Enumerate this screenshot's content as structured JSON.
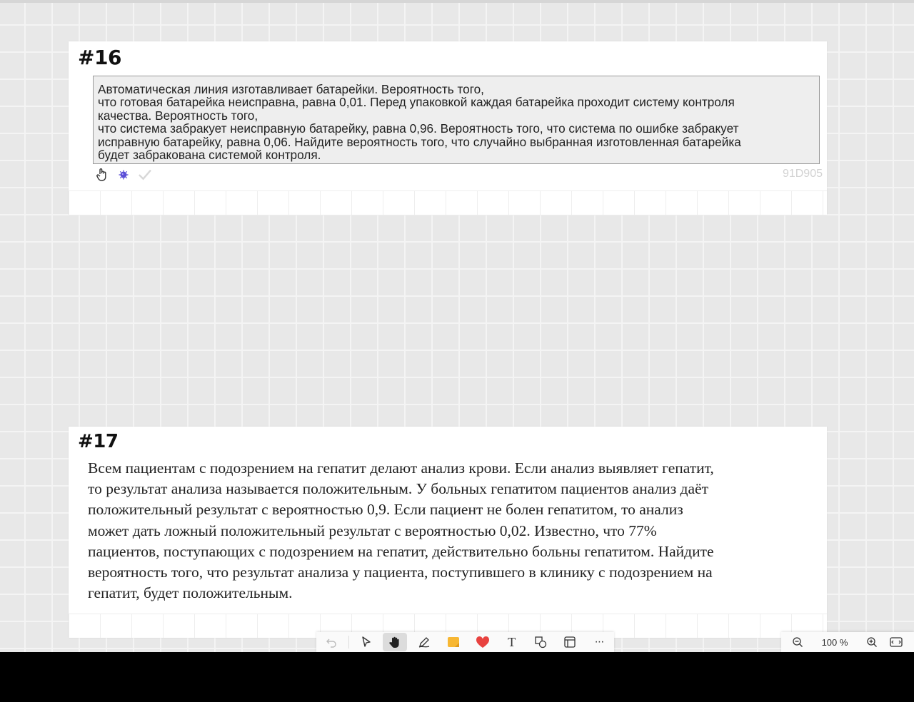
{
  "card16": {
    "title": "#16",
    "problem_lines": [
      "Автоматическая линия изготавливает батарейки. Вероятность того,",
      "что готовая батарейка неисправна, равна 0,01. Перед упаковкой каждая батарейка проходит систему контроля",
      "качества. Вероятность того,",
      "что система забракует неисправную батарейку, равна 0,96. Вероятность того, что система по ошибке забракует",
      "исправную батарейку, равна 0,06. Найдите вероятность того, что случайно выбранная изготовленная батарейка",
      "будет забракована системой контроля."
    ],
    "code": "91D905",
    "icons": [
      "hand-pointer-icon",
      "virus-icon",
      "checkmark-icon"
    ]
  },
  "card17": {
    "title": "#17",
    "problem_lines": [
      "Всем пациентам с подозрением на гепатит делают анализ крови. Если анализ выявляет гепатит,",
      "то результат анализа называется положительным. У больных гепатитом пациентов анализ даёт",
      "положительный результат с вероятностью 0,9. Если пациент не болен гепатитом, то анализ",
      "может дать ложный положительный результат с вероятностью 0,02. Известно, что 77%",
      "пациентов, поступающих с подозрением на гепатит, действительно больны гепатитом. Найдите",
      "вероятность того, что результат анализа у пациента, поступившего в клинику с подозрением на",
      "гепатит, будет положительным."
    ]
  },
  "toolbar": {
    "tools": [
      "undo-icon",
      "select-icon",
      "hand-icon",
      "pen-icon",
      "sticky-note-icon",
      "heart-icon",
      "text-icon",
      "shapes-icon",
      "frame-icon",
      "more-icon"
    ],
    "active_tool": "hand-icon",
    "more_label": "···",
    "text_tool_label": "T"
  },
  "zoom": {
    "level": "100 %"
  },
  "colors": {
    "heart": "#e8423f",
    "sticky": "#f7b733"
  }
}
